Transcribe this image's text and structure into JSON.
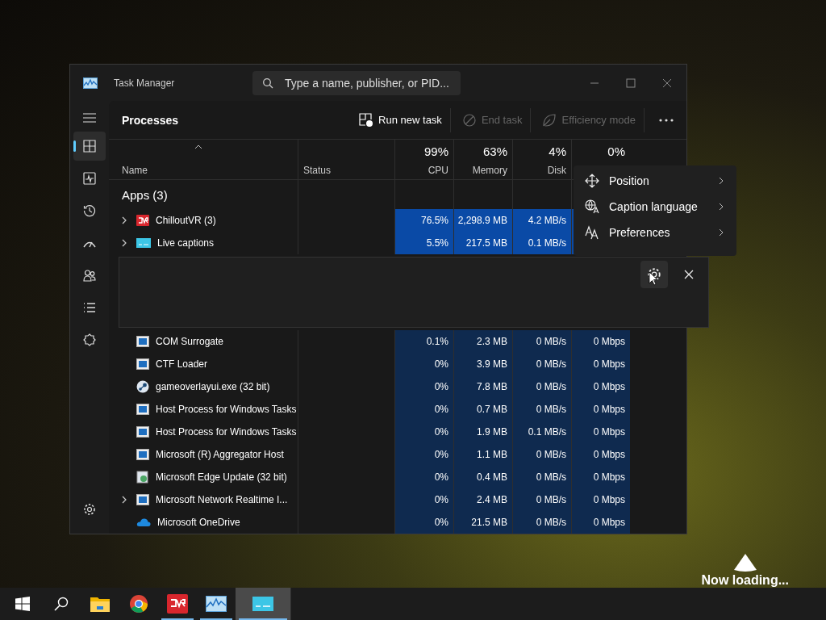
{
  "window": {
    "title": "Task Manager",
    "search": {
      "placeholder": "Type a name, publisher, or PID..."
    }
  },
  "sidebar": {
    "items": [
      {
        "kind": "processes",
        "selected": true
      },
      {
        "kind": "performance",
        "selected": false
      },
      {
        "kind": "history",
        "selected": false
      },
      {
        "kind": "startup",
        "selected": false
      },
      {
        "kind": "users",
        "selected": false
      },
      {
        "kind": "details",
        "selected": false
      },
      {
        "kind": "services",
        "selected": false
      }
    ]
  },
  "toolbar": {
    "title": "Processes",
    "actions": [
      {
        "kind": "run",
        "label": "Run new task",
        "disabled": false
      },
      {
        "kind": "end",
        "label": "End task",
        "disabled": true
      },
      {
        "kind": "efficiency",
        "label": "Efficiency mode",
        "disabled": true
      }
    ]
  },
  "table": {
    "columns": [
      {
        "label": "Name"
      },
      {
        "label": "Status"
      },
      {
        "label": "CPU",
        "total": "99%"
      },
      {
        "label": "Memory",
        "total": "63%"
      },
      {
        "label": "Disk",
        "total": "4%"
      },
      {
        "total": "0%"
      }
    ],
    "rows": [
      {
        "kind": "group",
        "name": "Apps (3)"
      },
      {
        "kind": "cvr",
        "name": "ChilloutVR (3)",
        "expandable": true,
        "highlighted": true,
        "cells": [
          "76.5%",
          "2,298.9 MB",
          "4.2 MB/s"
        ]
      },
      {
        "kind": "captions",
        "name": "Live captions",
        "expandable": true,
        "highlighted": true,
        "cells": [
          "5.5%",
          "217.5 MB",
          "0.1 MB/s"
        ]
      },
      {
        "kind": "caption_bar"
      },
      {
        "kind": "app",
        "name": "COM Surrogate",
        "expandable": false,
        "highlighted": false,
        "cells": [
          "0.1%",
          "2.3 MB",
          "0 MB/s",
          "0 Mbps"
        ]
      },
      {
        "kind": "app",
        "name": "CTF Loader",
        "expandable": false,
        "highlighted": false,
        "cells": [
          "0%",
          "3.9 MB",
          "0 MB/s",
          "0 Mbps"
        ]
      },
      {
        "kind": "steam",
        "name": "gameoverlayui.exe (32 bit)",
        "expandable": false,
        "highlighted": false,
        "cells": [
          "0%",
          "7.8 MB",
          "0 MB/s",
          "0 Mbps"
        ]
      },
      {
        "kind": "app",
        "name": "Host Process for Windows Tasks",
        "expandable": false,
        "highlighted": false,
        "cells": [
          "0%",
          "0.7 MB",
          "0 MB/s",
          "0 Mbps"
        ]
      },
      {
        "kind": "app",
        "name": "Host Process for Windows Tasks",
        "expandable": false,
        "highlighted": false,
        "cells": [
          "0%",
          "1.9 MB",
          "0.1 MB/s",
          "0 Mbps"
        ]
      },
      {
        "kind": "app",
        "name": "Microsoft (R) Aggregator Host",
        "expandable": false,
        "highlighted": false,
        "cells": [
          "0%",
          "1.1 MB",
          "0 MB/s",
          "0 Mbps"
        ]
      },
      {
        "kind": "update",
        "name": "Microsoft Edge Update (32 bit)",
        "expandable": false,
        "highlighted": false,
        "cells": [
          "0%",
          "0.4 MB",
          "0 MB/s",
          "0 Mbps"
        ]
      },
      {
        "kind": "app",
        "name": "Microsoft Network Realtime I...",
        "expandable": true,
        "highlighted": false,
        "cells": [
          "0%",
          "2.4 MB",
          "0 MB/s",
          "0 Mbps"
        ]
      },
      {
        "kind": "cloud",
        "name": "Microsoft OneDrive",
        "expandable": false,
        "highlighted": false,
        "cells": [
          "0%",
          "21.5 MB",
          "0 MB/s",
          "0 Mbps"
        ]
      }
    ]
  },
  "caption_menu": {
    "items": [
      {
        "kind": "position",
        "label": "Position"
      },
      {
        "kind": "language",
        "label": "Caption language"
      },
      {
        "kind": "preferences",
        "label": "Preferences"
      }
    ]
  },
  "background": {
    "loading": "Now loading..."
  },
  "taskbar": {
    "items": [
      {
        "kind": "start",
        "running": false,
        "active": false
      },
      {
        "kind": "search",
        "running": false,
        "active": false
      },
      {
        "kind": "explorer",
        "running": false,
        "active": false
      },
      {
        "kind": "chrome",
        "running": false,
        "active": false
      },
      {
        "kind": "cvr",
        "running": true,
        "active": false
      },
      {
        "kind": "taskmgr",
        "running": true,
        "active": false
      },
      {
        "kind": "captions",
        "running": true,
        "active": true
      }
    ]
  }
}
